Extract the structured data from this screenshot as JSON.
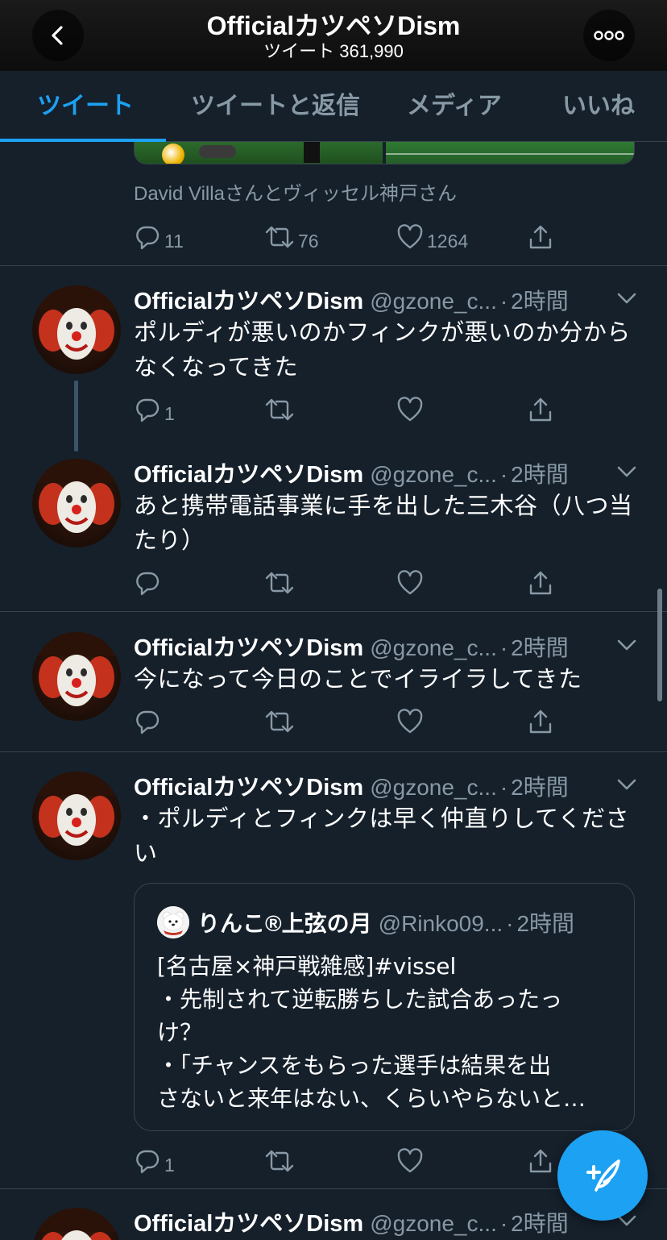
{
  "header": {
    "title": "OfficialカツペソDism",
    "subtitle": "ツイート 361,990"
  },
  "tabs": [
    {
      "label": "ツイート",
      "active": true
    },
    {
      "label": "ツイートと返信",
      "active": false
    },
    {
      "label": "メディア",
      "active": false
    },
    {
      "label": "いいね",
      "active": false
    }
  ],
  "previous_tweet": {
    "tagged_users": "David Villaさんとヴィッセル神戸さん",
    "reply_count": "11",
    "retweet_count": "76",
    "like_count": "1264"
  },
  "tweets": [
    {
      "name": "OfficialカツペソDism",
      "handle": "@gzone_c...",
      "time": "2時間",
      "text": "ポルディが悪いのかフィンクが悪いのか分からなくなってきた",
      "reply_count": "1",
      "retweet_count": "",
      "like_count": ""
    },
    {
      "name": "OfficialカツペソDism",
      "handle": "@gzone_c...",
      "time": "2時間",
      "text": "あと携帯電話事業に手を出した三木谷（八つ当たり）",
      "reply_count": "",
      "retweet_count": "",
      "like_count": ""
    },
    {
      "name": "OfficialカツペソDism",
      "handle": "@gzone_c...",
      "time": "2時間",
      "text": "今になって今日のことでイライラしてきた",
      "reply_count": "",
      "retweet_count": "",
      "like_count": ""
    },
    {
      "name": "OfficialカツペソDism",
      "handle": "@gzone_c...",
      "time": "2時間",
      "text": "・ポルディとフィンクは早く仲直りしてください",
      "reply_count": "1",
      "retweet_count": "",
      "like_count": "",
      "quote": {
        "name": "りんこ®上弦の月",
        "handle": "@Rinko09...",
        "time": "2時間",
        "lines": [
          "[名古屋×神戸戦雑感]#vissel",
          "・先制されて逆転勝ちした試合あったっ",
          "け？",
          "・「チャンスをもらった選手は結果を出",
          "さないと来年はない、くらいやらないと…"
        ]
      }
    },
    {
      "name": "OfficialカツペソDism",
      "handle": "@gzone_c...",
      "time": "2時間"
    }
  ],
  "colors": {
    "background": "#15202b",
    "accent": "#1da1f2",
    "secondary_text": "#8899a6",
    "divider": "#38444d"
  },
  "icons": {
    "back": "chevron-left-icon",
    "more": "more-dots-icon",
    "reply": "reply-icon",
    "retweet": "retweet-icon",
    "like": "heart-icon",
    "share": "share-icon",
    "menu": "chevron-down-icon",
    "compose": "compose-tweet-icon"
  }
}
